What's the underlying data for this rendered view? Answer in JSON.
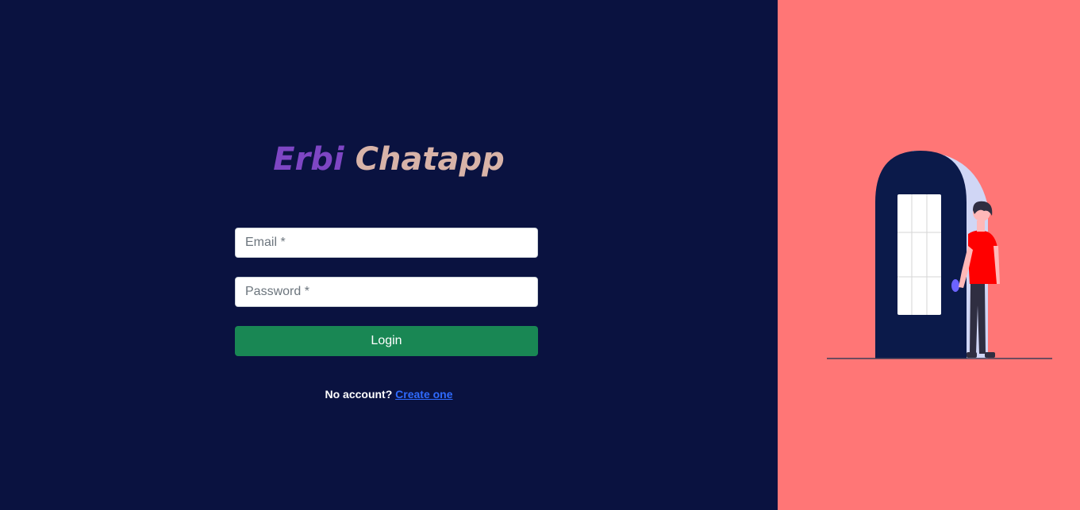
{
  "app": {
    "logo_word1": "Erbi",
    "logo_word2": "Chatapp"
  },
  "form": {
    "email_placeholder": "Email *",
    "password_placeholder": "Password *",
    "login_label": "Login"
  },
  "signup": {
    "prompt": "No account?",
    "link_label": "Create one"
  },
  "colors": {
    "left_background": "#0a1240",
    "right_background": "#ff7676",
    "login_button": "#198754",
    "link": "#2f6bff",
    "logo_word1": "#7e46c4",
    "logo_word2": "#d8b3a8"
  },
  "illustration": {
    "icon": "person-at-door-illustration"
  }
}
